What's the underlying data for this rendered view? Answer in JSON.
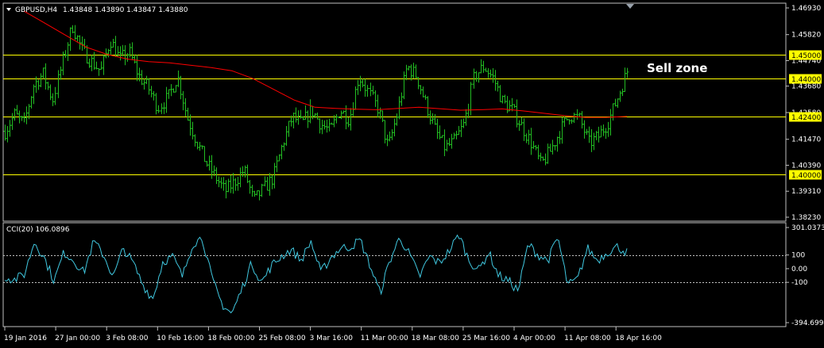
{
  "header": {
    "symbol": "GBPUSD,H4",
    "ohlc": "1.43848 1.43890 1.43847 1.43880"
  },
  "annotation": "Sell zone",
  "cci_header": "CCI(20) 106.0896",
  "colors": {
    "background": "#000000",
    "frame": "#c0c0c0",
    "bars": "#22bb22",
    "moving_average": "#ff0000",
    "level_lines": "#ffff00",
    "cci": "#40c8e0",
    "cci_levels": "#c0c0c0"
  },
  "chart_data": [
    {
      "type": "line",
      "name": "GBPUSD,H4",
      "y_ticks": [
        "1.46930",
        "1.45820",
        "1.44740",
        "1.43680",
        "1.42580",
        "1.41470",
        "1.40390",
        "1.39310",
        "1.38230"
      ],
      "ylim": [
        1.3823,
        1.4693
      ],
      "horizontal_levels": [
        {
          "value": 1.45,
          "label": "1.45000"
        },
        {
          "value": 1.44,
          "label": "1.44000"
        },
        {
          "value": 1.424,
          "label": "1.42400"
        },
        {
          "value": 1.4,
          "label": "1.40000"
        }
      ],
      "x_ticks": [
        "19 Jan 2016",
        "27 Jan 00:00",
        "3 Feb 08:00",
        "10 Feb 16:00",
        "18 Feb 00:00",
        "25 Feb 08:00",
        "3 Mar 16:00",
        "11 Mar 00:00",
        "18 Mar 08:00",
        "25 Mar 16:00",
        "4 Apr 00:00",
        "11 Apr 08:00",
        "18 Apr 16:00"
      ],
      "price_path": [
        1.418,
        1.425,
        1.421,
        1.437,
        1.442,
        1.431,
        1.447,
        1.462,
        1.452,
        1.447,
        1.443,
        1.456,
        1.448,
        1.451,
        1.441,
        1.436,
        1.428,
        1.432,
        1.441,
        1.424,
        1.414,
        1.405,
        1.399,
        1.393,
        1.397,
        1.402,
        1.389,
        1.394,
        1.399,
        1.413,
        1.424,
        1.421,
        1.427,
        1.421,
        1.418,
        1.427,
        1.423,
        1.441,
        1.434,
        1.427,
        1.411,
        1.426,
        1.445,
        1.441,
        1.429,
        1.418,
        1.411,
        1.414,
        1.421,
        1.441,
        1.445,
        1.44,
        1.43,
        1.427,
        1.42,
        1.413,
        1.404,
        1.41,
        1.418,
        1.425,
        1.423,
        1.413,
        1.416,
        1.422,
        1.432,
        1.443
      ],
      "moving_average": [
        1.468,
        1.463,
        1.458,
        1.453,
        1.45,
        1.448,
        1.447,
        1.4465,
        1.4455,
        1.4445,
        1.4432,
        1.44,
        1.4355,
        1.431,
        1.428,
        1.4275,
        1.4272,
        1.427,
        1.4275,
        1.428,
        1.4274,
        1.4268,
        1.427,
        1.4273,
        1.4265,
        1.4255,
        1.4245,
        1.4238,
        1.4238,
        1.4242
      ],
      "cci_ticks": [
        "301.0373",
        "100",
        "0.00",
        "-100",
        "-394.6994"
      ],
      "cci_range": [
        -394.6994,
        301.0373
      ],
      "cci_levels": [
        100,
        -100
      ],
      "cci_path": [
        -60,
        -80,
        -40,
        200,
        80,
        -90,
        120,
        60,
        -30,
        200,
        100,
        -60,
        150,
        40,
        -120,
        -220,
        50,
        90,
        -60,
        180,
        230,
        -80,
        -260,
        -330,
        -150,
        40,
        -100,
        20,
        90,
        140,
        60,
        200,
        -30,
        80,
        150,
        160,
        210,
        20,
        -180,
        60,
        230,
        100,
        -60,
        90,
        40,
        130,
        250,
        60,
        -10,
        120,
        -50,
        -90,
        -160,
        180,
        100,
        60,
        230,
        -120,
        -80,
        150,
        60,
        120,
        160,
        120
      ]
    }
  ]
}
